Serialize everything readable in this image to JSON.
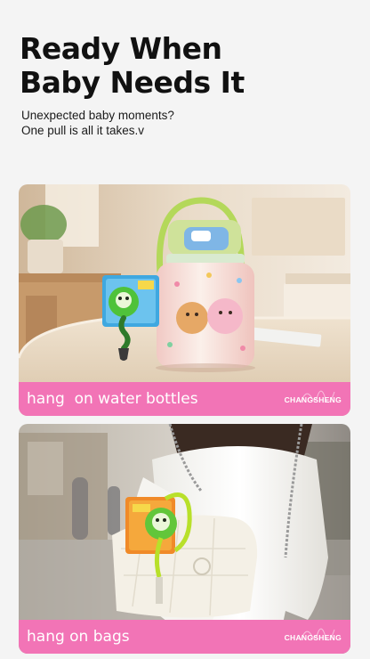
{
  "hero": {
    "title_line1": "Ready When",
    "title_line2": "Baby Needs It",
    "subtitle_line1": "Unexpected baby moments?",
    "subtitle_line2": "One pull is all it takes.v"
  },
  "cards": [
    {
      "caption": "hang  on water bottles",
      "brand": "CHANGSHENG"
    },
    {
      "caption": "hang on bags",
      "brand": "CHANGSHENG"
    }
  ],
  "colors": {
    "page_background": "#f4f4f4",
    "caption_bar": "#f274b6",
    "caption_text": "#ffffff",
    "title_text": "#111111"
  }
}
